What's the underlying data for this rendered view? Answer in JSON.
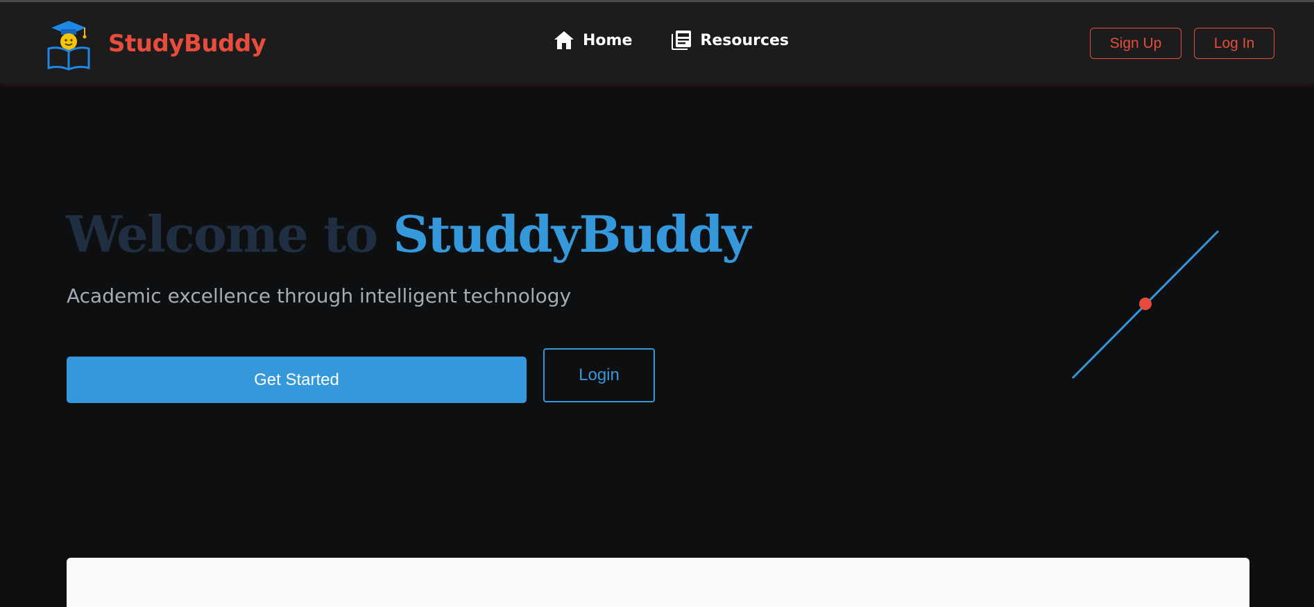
{
  "brand": {
    "name": "StudyBuddy",
    "logo_icon": "student-book-logo-icon"
  },
  "nav": {
    "items": [
      {
        "label": "Home",
        "icon": "home-icon"
      },
      {
        "label": "Resources",
        "icon": "newspaper-icon"
      }
    ]
  },
  "auth": {
    "signup_label": "Sign Up",
    "login_label": "Log In"
  },
  "hero": {
    "title_prefix": "Welcome to ",
    "title_highlight": "StuddyBuddy",
    "subtitle": "Academic excellence through intelligent technology",
    "primary_cta": "Get Started",
    "secondary_cta": "Login"
  },
  "colors": {
    "accent_red": "#e74c3c",
    "accent_blue": "#3498db",
    "background": "#0e0f11",
    "navbar": "#1c1c1d",
    "title_muted": "#1f2e40",
    "card": "#f8f9fa"
  }
}
